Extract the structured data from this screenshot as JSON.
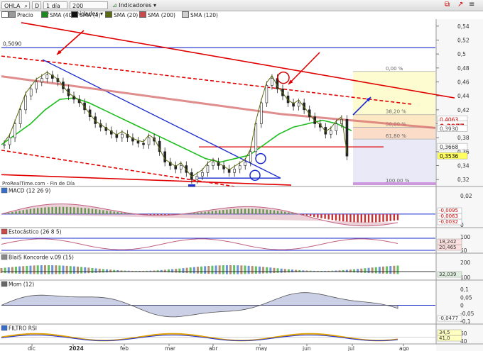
{
  "toolbar": {
    "ticker": "OHLA",
    "ticker_mode": "D",
    "period": "1 día",
    "units": "200 unidades",
    "indicators": "Indicadores"
  },
  "legend": [
    {
      "label": "Precio",
      "color": "#9a9a9a"
    },
    {
      "label": "SMA (40)",
      "color": "#1a8a1a"
    },
    {
      "label": "SMA (4)",
      "color": "#111111"
    },
    {
      "label": "SMA (20)",
      "color": "#5a6a10"
    },
    {
      "label": "SMA (200)",
      "color": "#c84a4a"
    },
    {
      "label": "SMA (120)",
      "color": "#cfcfcf"
    }
  ],
  "main": {
    "level_label": "0,5090",
    "source": "ProRealTime.com - Fin de Día",
    "y_ticks": [
      "0,54",
      "0,52",
      "0,5",
      "0,48",
      "0,46",
      "0,44",
      "0,42",
      "0,4",
      "0,38",
      "0,36",
      "0,34",
      "0,32"
    ],
    "fib_labels": [
      "0,00 %",
      "38,20 %",
      "50,00 %",
      "61,80 %",
      "100,00 %"
    ],
    "price_boxes": [
      {
        "text": "0,4063",
        "fg": "#d00000",
        "bg": "#ffffff"
      },
      {
        "text": "0,3977",
        "fg": "#d00000",
        "bg": "#ffffff"
      },
      {
        "text": "0,3930",
        "fg": "#555555",
        "bg": "#ffffff"
      },
      {
        "text": "0,3668",
        "fg": "#333333",
        "bg": "#ffffff"
      },
      {
        "text": "0,3536",
        "fg": "#000000",
        "bg": "#ffff60"
      }
    ]
  },
  "panels": [
    {
      "title": "MACD (12 26 9)",
      "ticks": [
        "0,02",
        "0"
      ],
      "values": [
        "-0,0032",
        "-0,0063",
        "-0,0095"
      ]
    },
    {
      "title": "Estocástico (26 8 5)",
      "ticks": [
        "100",
        "50"
      ],
      "values": [
        "20,465",
        "18,242"
      ]
    },
    {
      "title": "BlaiS Koncorde v.09 (15)",
      "ticks": [
        "200",
        "100"
      ],
      "values": [
        "32,039"
      ]
    },
    {
      "title": "Mom (12)",
      "ticks": [
        "0,1",
        "0,05",
        "0",
        "-0,05",
        "-0,1"
      ],
      "values": [
        "-0,0477"
      ]
    },
    {
      "title": "FILTRO RSI",
      "ticks": [
        "60",
        "40"
      ],
      "values": [
        "41,0",
        "34,5"
      ]
    }
  ],
  "x_axis": [
    "dic",
    "2024",
    "feb",
    "mar",
    "abr",
    "may",
    "jun",
    "jul",
    "ago"
  ],
  "colors": {
    "trend_red": "#e00000",
    "trend_blue": "#1a2ad0",
    "sma200": "#c84a4a",
    "sma40": "#1a8a1a"
  },
  "chart_data": {
    "type": "candlestick",
    "title": "OHLA",
    "period": "1 día",
    "x_labels": [
      "dic",
      "2024",
      "feb",
      "mar",
      "abr",
      "may",
      "jun",
      "jul",
      "ago"
    ],
    "ylim": [
      0.31,
      0.55
    ],
    "series": [
      {
        "name": "Precio",
        "close": [
          0.37,
          0.38,
          0.4,
          0.42,
          0.44,
          0.45,
          0.46,
          0.465,
          0.47,
          0.465,
          0.46,
          0.45,
          0.44,
          0.435,
          0.43,
          0.42,
          0.41,
          0.4,
          0.395,
          0.39,
          0.385,
          0.38,
          0.385,
          0.38,
          0.375,
          0.372,
          0.37,
          0.38,
          0.375,
          0.36,
          0.345,
          0.34,
          0.335,
          0.34,
          0.33,
          0.32,
          0.325,
          0.33,
          0.34,
          0.345,
          0.34,
          0.335,
          0.33,
          0.335,
          0.34,
          0.345,
          0.36,
          0.4,
          0.43,
          0.455,
          0.465,
          0.45,
          0.44,
          0.43,
          0.425,
          0.43,
          0.42,
          0.41,
          0.4,
          0.395,
          0.385,
          0.39,
          0.4,
          0.4063,
          0.3536
        ]
      },
      {
        "name": "SMA (200)",
        "values": [
          0.468,
          0.462,
          0.456,
          0.45,
          0.444,
          0.438,
          0.432,
          0.426,
          0.42,
          0.414,
          0.41,
          0.406,
          0.402,
          0.398,
          0.394
        ]
      },
      {
        "name": "SMA (40)",
        "values": [
          0.37,
          0.385,
          0.4,
          0.42,
          0.435,
          0.437,
          0.43,
          0.42,
          0.41,
          0.4,
          0.39,
          0.38,
          0.37,
          0.36,
          0.35,
          0.345,
          0.35,
          0.355,
          0.37,
          0.385,
          0.395,
          0.4,
          0.405,
          0.4,
          0.39
        ]
      }
    ],
    "fibonacci": [
      {
        "label": "0,00 %",
        "value": 0.475
      },
      {
        "label": "38,20 %",
        "value": 0.413
      },
      {
        "label": "50,00 %",
        "value": 0.395
      },
      {
        "label": "61,80 %",
        "value": 0.378
      },
      {
        "label": "100,00 %",
        "value": 0.314
      }
    ],
    "horizontal_levels": [
      {
        "label": "0,5090",
        "value": 0.509
      },
      {
        "value": 0.3668
      }
    ],
    "last_values": {
      "close": 0.3536,
      "sma20": 0.3977,
      "level_a": 0.4063,
      "level_b": 0.393
    }
  }
}
